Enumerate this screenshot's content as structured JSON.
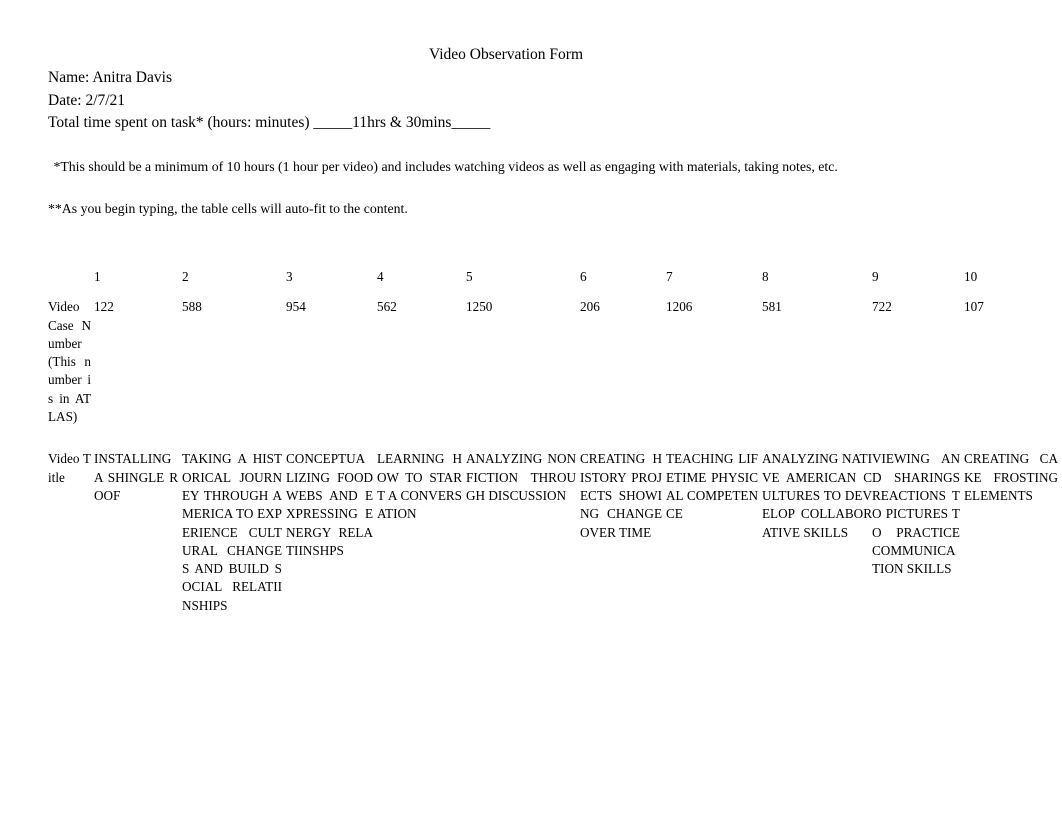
{
  "document": {
    "title": "Video Observation Form",
    "name_line": "Name: Anitra Davis",
    "date_line": "Date: 2/7/21",
    "total_time_line": "Total time spent on task* (hours: minutes) _____11hrs & 30mins_____",
    "note_1": " *This should be a minimum of 10 hours (1 hour per video) and includes watching videos as well as engaging with materials, taking notes, etc.",
    "note_2": "**As you begin typing, the table cells will auto-fit to the content."
  },
  "table": {
    "corner_label": "",
    "column_headers": [
      "1",
      "2",
      "3",
      "4",
      "5",
      "6",
      "7",
      "8",
      "9",
      "10"
    ],
    "rows": [
      {
        "label": "Video Case Number (This number is in ATLAS)",
        "values": [
          "122",
          "588",
          "954",
          "562",
          "1250",
          "206",
          "1206",
          "581",
          "722",
          "107"
        ]
      },
      {
        "label": "Video Title",
        "values": [
          "INSTALLING A SHINGLE ROOF",
          "TAKING A HISTORICAL JOURNEY THROUGH AMERICA TO EXPERIENCE CULTURAL CHANGES AND BUILD SOCIAL RELATIINSHIPS",
          "CONCEPTUALIZING FOOD WEBS AND EXPRESSING ENERGY RELATIINSHPS",
          "LEARNING HOW TO START A CONVERSATION",
          "ANALYZING NONFICTION THROUGH DISCUSSION",
          "CREATING HISTORY PROJECTS SHOWING CHANGE OVER TIME",
          "TEACHING LIFETIME PHYSICAL COMPETENCE",
          "ANALYZING NATIVE AMERICAN CULTURES TO DEVELOP COLLABORATIVE SKILLS",
          "VIEWING AND SHARINGS REACTIONS TO PICTURES TO PRACTICE COMMUNICATION SKILLS",
          "CREATING CAKE FROSTING ELEMENTS"
        ]
      }
    ]
  },
  "colors": {
    "page_background": "#ffffff",
    "text": "#000000"
  }
}
